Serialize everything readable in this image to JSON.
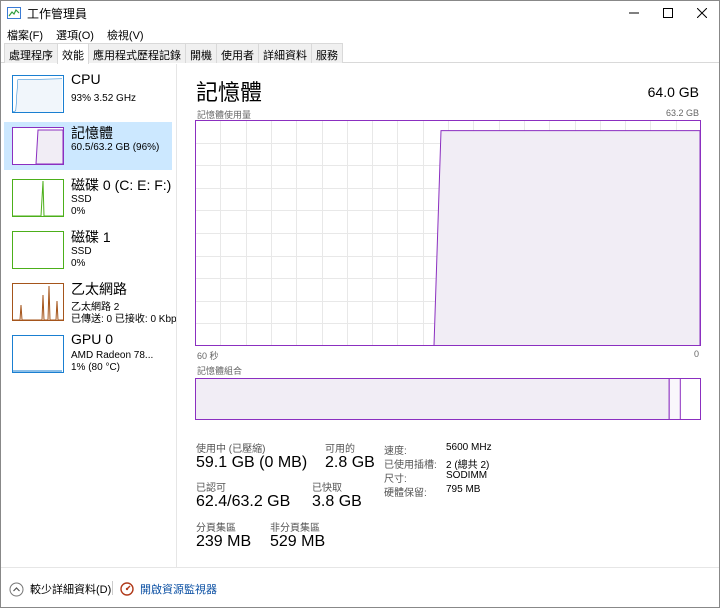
{
  "window": {
    "title": "工作管理員"
  },
  "menu": [
    "檔案(F)",
    "選項(O)",
    "檢視(V)"
  ],
  "tabs": [
    {
      "label": "處理程序",
      "active": false
    },
    {
      "label": "效能",
      "active": true
    },
    {
      "label": "應用程式歷程記錄",
      "active": false
    },
    {
      "label": "開機",
      "active": false
    },
    {
      "label": "使用者",
      "active": false
    },
    {
      "label": "詳細資料",
      "active": false
    },
    {
      "label": "服務",
      "active": false
    }
  ],
  "sidebar": {
    "items": [
      {
        "name": "CPU",
        "sub1": "93% 3.52 GHz",
        "sub2": "",
        "color": "#1a7fd1"
      },
      {
        "name": "記憶體",
        "sub1": "60.5/63.2 GB (96%)",
        "sub2": "",
        "color": "#8b2fc0",
        "selected": true
      },
      {
        "name": "磁碟 0 (C: E: F:)",
        "sub1": "SSD",
        "sub2": "0%",
        "color": "#4caf1a"
      },
      {
        "name": "磁碟 1",
        "sub1": "SSD",
        "sub2": "0%",
        "color": "#4caf1a"
      },
      {
        "name": "乙太網路",
        "sub1": "乙太網路 2",
        "sub2": "已傳送: 0 已接收: 0 Kbps",
        "color": "#a5551b"
      },
      {
        "name": "GPU 0",
        "sub1": "AMD Radeon 78...",
        "sub2": "1% (80 °C)",
        "color": "#1a7fd1"
      }
    ]
  },
  "main": {
    "title": "記憶體",
    "total": "64.0 GB",
    "usage_label": "記憶體使用量",
    "usage_max": "63.2 GB",
    "axis_left": "60 秒",
    "axis_right": "0",
    "composition_label": "記憶體組合",
    "usage_fraction": 0.957,
    "composition_in_use_fraction": 0.938,
    "composition_modified_fraction": 0.022
  },
  "stats": {
    "in_use_label": "使用中 (已壓縮)",
    "in_use_value": "59.1 GB (0 MB)",
    "available_label": "可用的",
    "available_value": "2.8 GB",
    "committed_label": "已認可",
    "committed_value": "62.4/63.2 GB",
    "cached_label": "已快取",
    "cached_value": "3.8 GB",
    "paged_label": "分頁集區",
    "paged_value": "239 MB",
    "nonpaged_label": "非分頁集區",
    "nonpaged_value": "529 MB"
  },
  "specs": [
    {
      "label": "速度:",
      "value": "5600 MHz"
    },
    {
      "label": "已使用插槽:",
      "value": "2 (總共 2)"
    },
    {
      "label": "尺寸:",
      "value": "SODIMM"
    },
    {
      "label": "硬體保留:",
      "value": "795 MB"
    }
  ],
  "bottom": {
    "fewer_details": "較少詳細資料(D)",
    "open_monitor": "開啟資源監視器"
  },
  "colors": {
    "memory": "#8b2fc0",
    "memory_fill": "#f1edf5",
    "selected": "#cce8ff"
  }
}
